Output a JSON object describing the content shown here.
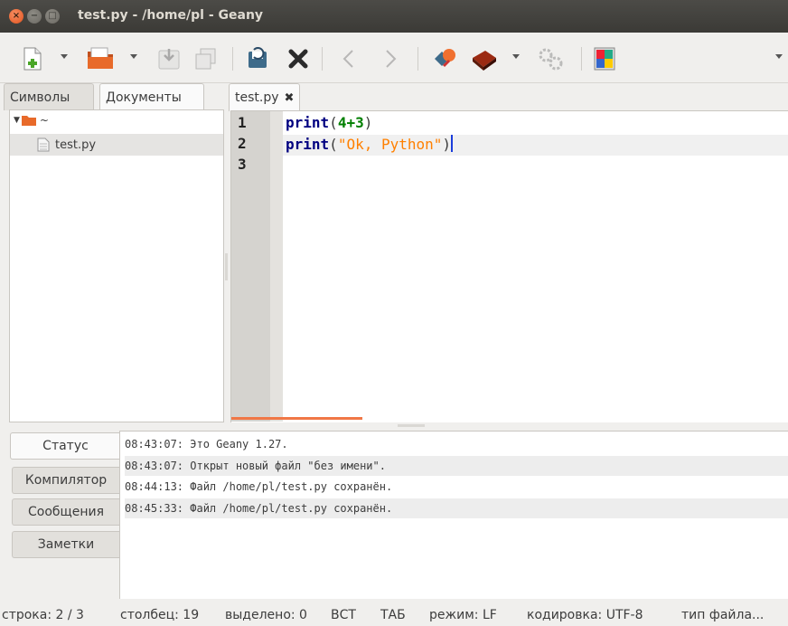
{
  "window": {
    "title": "test.py - /home/pl - Geany",
    "close_glyph": "×",
    "min_glyph": "−",
    "max_glyph": "□"
  },
  "toolbar": {
    "buttons": [
      "new-file-icon",
      "open-file-icon",
      "save-icon",
      "save-all-icon",
      "revert-icon",
      "close-file-icon",
      "back-icon",
      "forward-icon",
      "compile-icon",
      "build-icon",
      "run-icon",
      "color-chooser-icon"
    ]
  },
  "sidebar": {
    "tabs": [
      "Символы",
      "Документы"
    ],
    "active_tab": "Документы",
    "tree": {
      "root_label": "~",
      "file_label": "test.py"
    }
  },
  "editor": {
    "tab_label": "test.py",
    "close_glyph": "✖",
    "line_numbers": [
      "1",
      "2",
      "3"
    ],
    "lines": [
      {
        "fn": "print",
        "open": "(",
        "arg": "4+3",
        "close": ")"
      },
      {
        "fn": "print",
        "open": "(",
        "arg": "\"Ok, Python\"",
        "close": ")"
      },
      {
        "fn": "",
        "open": "",
        "arg": "",
        "close": ""
      }
    ]
  },
  "messages": {
    "tabs": [
      "Статус",
      "Компилятор",
      "Сообщения",
      "Заметки"
    ],
    "active_tab": "Статус",
    "lines": [
      "08:43:07: Это Geany 1.27.",
      "08:43:07: Открыт новый файл \"без имени\".",
      "08:44:13: Файл /home/pl/test.py сохранён.",
      "08:45:33: Файл /home/pl/test.py сохранён."
    ]
  },
  "statusbar": {
    "line": "строка: 2 / 3",
    "column": "столбец: 19",
    "selected": "выделено: 0",
    "insert_mode": "ВСТ",
    "indent": "ТАБ",
    "eol_mode": "режим: LF",
    "encoding": "кодировка: UTF-8",
    "filetype": "тип файла..."
  }
}
